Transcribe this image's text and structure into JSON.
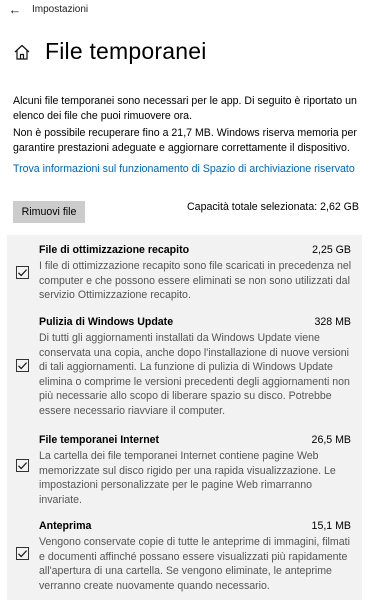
{
  "titlebar": {
    "back_icon": "←",
    "title": "Impostazioni"
  },
  "header": {
    "icon": "home-icon",
    "title": "File temporanei"
  },
  "intro": {
    "paragraph1": "Alcuni file temporanei sono necessari per le app. Di seguito è riportato un elenco dei file che puoi rimuovere ora.",
    "paragraph2": "Non è possibile recuperare fino a 21,7 MB. Windows riserva memoria per garantire prestazioni adeguate e aggiornare correttamente il dispositivo.",
    "link": "Trova informazioni sul funzionamento di Spazio di archiviazione riservato"
  },
  "actions": {
    "remove_label": "Rimuovi file",
    "total_label": "Capacità totale selezionata: 2,62 GB"
  },
  "items": [
    {
      "title": "File di ottimizzazione recapito",
      "size": "2,25 GB",
      "checked": true,
      "description": "I file di ottimizzazione recapito sono file scaricati in precedenza nel computer e che possono essere eliminati se non sono utilizzati dal servizio Ottimizzazione recapito."
    },
    {
      "title": "Pulizia di Windows Update",
      "size": "328 MB",
      "checked": true,
      "description": "Di tutti gli aggiornamenti installati da Windows Update viene conservata una copia, anche dopo l'installazione di nuove versioni di tali aggiornamenti. La funzione di pulizia di Windows Update elimina o comprime le versioni precedenti degli aggiornamenti non più necessarie allo scopo di liberare spazio su disco. Potrebbe essere necessario riavviare il computer."
    },
    {
      "title": "File temporanei Internet",
      "size": "26,5 MB",
      "checked": true,
      "description": "La cartella dei file temporanei Internet contiene pagine Web memorizzate sul disco rigido per una rapida visualizzazione. Le impostazioni personalizzate per le pagine Web rimarranno invariate."
    },
    {
      "title": "Anteprima",
      "size": "15,1 MB",
      "checked": true,
      "description": "Vengono conservate copie di tutte le anteprime di immagini, filmati e documenti affinché possano essere visualizzati più rapidamente all'apertura di una cartella. Se vengono eliminate, le anteprime verranno create nuovamente quando necessario."
    }
  ]
}
